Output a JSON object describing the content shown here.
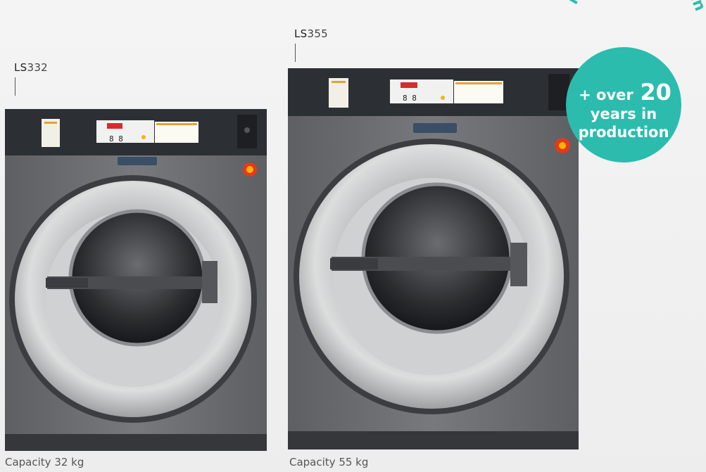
{
  "products": [
    {
      "model_prefix": "LS",
      "model_number": "332",
      "capacity": "Capacity 32 kg",
      "display_digits": "8 8"
    },
    {
      "model_prefix": "LS",
      "model_number": "355",
      "capacity": "Capacity 55 kg",
      "display_digits": "8 8"
    }
  ],
  "badge": {
    "arc_text": "More than proven",
    "line1_prefix": "+ over",
    "line1_number": "20",
    "line2": "years in",
    "line3": "production",
    "color": "#2bbcae"
  },
  "colors": {
    "cabinet": "#707276",
    "control_panel": "#2c2f33",
    "steel": "#c9cbcc",
    "stop_button": "#e33a1c"
  }
}
